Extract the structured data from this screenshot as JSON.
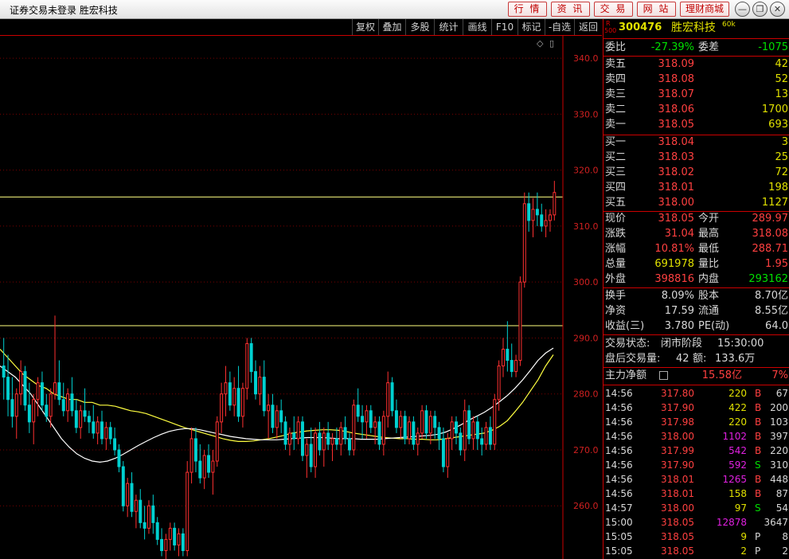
{
  "window": {
    "title": "证券交易未登录  胜宏科技",
    "nav": [
      "行 情",
      "资 讯",
      "交 易",
      "网 站",
      "理财商城"
    ],
    "controls": [
      "—",
      "❐",
      "✕"
    ]
  },
  "toolbar": [
    "复权",
    "叠加",
    "多股",
    "统计",
    "画线",
    "F10",
    "标记",
    "-自选",
    "返回"
  ],
  "chart": {
    "y_ticks": [
      "340.0",
      "330.0",
      "320.0",
      "310.0",
      "300.0",
      "290.0",
      "280.0",
      "270.0",
      "260.0"
    ],
    "top_icons": [
      "◇",
      "▯"
    ]
  },
  "chart_data": {
    "type": "candlestick",
    "title": "",
    "ylim": [
      250.5,
      344
    ],
    "y_ticks": [
      340,
      330,
      320,
      310,
      300,
      290,
      280,
      270,
      260
    ],
    "hlines": [
      315.2,
      292.2
    ],
    "grid": "horizontal dotted",
    "up_color": "#ff3030",
    "down_color": "#00d0d0",
    "ma_colors": [
      "#ffff40",
      "#ffffff"
    ],
    "candles": [
      [
        285,
        290,
        279,
        283
      ],
      [
        283,
        287,
        276,
        279
      ],
      [
        279,
        283,
        274,
        276
      ],
      [
        276,
        281,
        272,
        280
      ],
      [
        280,
        286,
        278,
        284
      ],
      [
        284,
        285,
        277,
        278
      ],
      [
        278,
        282,
        273,
        275
      ],
      [
        275,
        280,
        271,
        279
      ],
      [
        279,
        283,
        276,
        282
      ],
      [
        282,
        284,
        277,
        278
      ],
      [
        278,
        280,
        275,
        276
      ],
      [
        276,
        281,
        274,
        280
      ],
      [
        280,
        294,
        279,
        282
      ],
      [
        282,
        286,
        278,
        279
      ],
      [
        279,
        282,
        276,
        277
      ],
      [
        277,
        281,
        275,
        280
      ],
      [
        280,
        283,
        276,
        277
      ],
      [
        277,
        279,
        273,
        274
      ],
      [
        274,
        278,
        272,
        277
      ],
      [
        277,
        281,
        275,
        276
      ],
      [
        276,
        277,
        273,
        275
      ],
      [
        275,
        278,
        272,
        273
      ],
      [
        273,
        276,
        271,
        275
      ],
      [
        275,
        277,
        271,
        272
      ],
      [
        272,
        275,
        270,
        274
      ],
      [
        274,
        275,
        271,
        272
      ],
      [
        272,
        274,
        269,
        270
      ],
      [
        270,
        271,
        266,
        267
      ],
      [
        267,
        268,
        259,
        260
      ],
      [
        260,
        265,
        258,
        264
      ],
      [
        264,
        266,
        258,
        259
      ],
      [
        259,
        262,
        256,
        261
      ],
      [
        261,
        263,
        256,
        257
      ],
      [
        257,
        260,
        254,
        256
      ],
      [
        256,
        261,
        255,
        260
      ],
      [
        260,
        262,
        255,
        257
      ],
      [
        257,
        258,
        253,
        254
      ],
      [
        254,
        256,
        251,
        252
      ],
      [
        252,
        255,
        250.5,
        254
      ],
      [
        254,
        257,
        252,
        256
      ],
      [
        256,
        257,
        252,
        253
      ],
      [
        253,
        256,
        251,
        255
      ],
      [
        255,
        256,
        251,
        252
      ],
      [
        252,
        268,
        251,
        266
      ],
      [
        266,
        274,
        264,
        272
      ],
      [
        272,
        274,
        266,
        268
      ],
      [
        268,
        271,
        264,
        265
      ],
      [
        265,
        270,
        263,
        269
      ],
      [
        269,
        271,
        265,
        266
      ],
      [
        266,
        270,
        262,
        268
      ],
      [
        268,
        276,
        267,
        275
      ],
      [
        275,
        282,
        273,
        280
      ],
      [
        280,
        285,
        276,
        282
      ],
      [
        282,
        284,
        277,
        278
      ],
      [
        278,
        283,
        276,
        281
      ],
      [
        281,
        285,
        275,
        276
      ],
      [
        276,
        282,
        274,
        281
      ],
      [
        281,
        290,
        279,
        289
      ],
      [
        289,
        290,
        282,
        284
      ],
      [
        284,
        286,
        279,
        280
      ],
      [
        280,
        285,
        278,
        283
      ],
      [
        283,
        286,
        276,
        277
      ],
      [
        277,
        280,
        272,
        278
      ],
      [
        278,
        280,
        273,
        274
      ],
      [
        274,
        278,
        272,
        277
      ],
      [
        277,
        279,
        273,
        275
      ],
      [
        275,
        276,
        270,
        271
      ],
      [
        271,
        274,
        269,
        273
      ],
      [
        273,
        276,
        270,
        272
      ],
      [
        272,
        276,
        271,
        275
      ],
      [
        275,
        276,
        268,
        269
      ],
      [
        269,
        272,
        265,
        271
      ],
      [
        271,
        274,
        266,
        267
      ],
      [
        267,
        274,
        265,
        273
      ],
      [
        273,
        275,
        269,
        270
      ],
      [
        270,
        274,
        267,
        273
      ],
      [
        273,
        275,
        270,
        271
      ],
      [
        271,
        273,
        268,
        272
      ],
      [
        272,
        274,
        270,
        271
      ],
      [
        271,
        275,
        269,
        274
      ],
      [
        274,
        276,
        271,
        272
      ],
      [
        272,
        273,
        269,
        270
      ],
      [
        270,
        279,
        269,
        278
      ],
      [
        278,
        281,
        275,
        276
      ],
      [
        276,
        278,
        272,
        275
      ],
      [
        275,
        278,
        272,
        277
      ],
      [
        277,
        278,
        273,
        274
      ],
      [
        274,
        276,
        271,
        275
      ],
      [
        275,
        276,
        270,
        271
      ],
      [
        271,
        277,
        269,
        276
      ],
      [
        276,
        284,
        274,
        282
      ],
      [
        282,
        283,
        276,
        277
      ],
      [
        277,
        279,
        273,
        274
      ],
      [
        274,
        277,
        272,
        276
      ],
      [
        276,
        277,
        271,
        272
      ],
      [
        272,
        276,
        271,
        275
      ],
      [
        275,
        276,
        270,
        271
      ],
      [
        271,
        274,
        269,
        273
      ],
      [
        273,
        278,
        272,
        277
      ],
      [
        277,
        278,
        272,
        273
      ],
      [
        273,
        277,
        271,
        276
      ],
      [
        276,
        277,
        272,
        274
      ],
      [
        274,
        275,
        270,
        272
      ],
      [
        272,
        274,
        266,
        267
      ],
      [
        267,
        273,
        265,
        272
      ],
      [
        272,
        276,
        270,
        275
      ],
      [
        275,
        276,
        271,
        273
      ],
      [
        273,
        274,
        269,
        270
      ],
      [
        270,
        279,
        268,
        277
      ],
      [
        277,
        278,
        271,
        272
      ],
      [
        272,
        276,
        270,
        275
      ],
      [
        275,
        276,
        270,
        272
      ],
      [
        272,
        274,
        269,
        271
      ],
      [
        271,
        275,
        270,
        274
      ],
      [
        274,
        276,
        270,
        271
      ],
      [
        271,
        280,
        270,
        279
      ],
      [
        279,
        286,
        277,
        285
      ],
      [
        285,
        290,
        283,
        288
      ],
      [
        288,
        293,
        284,
        286
      ],
      [
        286,
        289,
        283,
        284
      ],
      [
        284,
        287,
        283,
        286
      ],
      [
        286,
        301,
        285,
        300
      ],
      [
        300,
        316,
        299,
        314
      ],
      [
        314,
        316,
        309,
        311
      ],
      [
        311,
        315,
        308,
        313
      ],
      [
        313,
        316,
        310,
        312
      ],
      [
        312,
        314,
        309,
        310
      ],
      [
        310,
        313,
        308,
        311
      ],
      [
        311,
        313,
        309,
        312
      ],
      [
        312,
        318.08,
        311,
        316
      ]
    ],
    "ma_short": [
      288,
      286.5,
      285,
      283.5,
      282.5,
      281.5,
      281,
      280,
      279.5,
      279,
      279,
      278.5,
      278.5,
      278,
      278,
      277.8,
      277.4,
      277,
      276.8,
      276.5,
      276,
      275.5,
      275,
      274.5,
      274,
      273.6,
      273.2,
      272.8,
      272.4,
      272,
      271.7,
      271.5,
      271.5,
      271.6,
      271.8,
      272,
      272.3,
      272.6,
      273,
      273.2,
      273.4,
      273.5,
      273.6,
      273.6,
      273.5,
      273.3,
      273,
      272.8,
      272.6,
      272.4,
      272.2,
      272.1,
      272,
      272,
      271.9,
      271.9,
      271.8,
      271.8,
      272,
      272.2,
      272.4,
      272.6,
      272.8,
      273,
      273.5,
      274.2,
      275.2,
      276.8,
      278.5,
      280.5,
      282.5,
      285,
      287
    ],
    "ma_long": [
      285,
      284,
      283,
      281.5,
      280,
      278,
      276,
      274,
      272,
      270.5,
      269.3,
      268.5,
      268,
      267.8,
      268,
      268.5,
      269.2,
      270,
      270.8,
      271.5,
      272.2,
      272.8,
      273.3,
      273.6,
      273.8,
      273.8,
      273.6,
      273.3,
      273,
      272.7,
      272.4,
      272.2,
      272,
      271.9,
      271.8,
      271.8,
      271.8,
      271.9,
      272,
      272.1,
      272.2,
      272.2,
      272.2,
      272.1,
      272,
      272,
      272,
      271.9,
      271.9,
      271.9,
      272,
      272.1,
      272.2,
      272.3,
      272.4,
      272.5,
      272.6,
      272.8,
      273.2,
      273.8,
      274.5,
      275.3,
      276,
      276.7,
      277.6,
      278.6,
      279.7,
      281,
      282.5,
      284.2,
      286,
      287.3,
      288.2
    ]
  },
  "quote": {
    "code": "300476",
    "name": "胜宏科技",
    "period": "60k",
    "badge": [
      "R",
      "500"
    ],
    "weibi": {
      "label": "委比",
      "value": "-27.39%",
      "label2": "委差",
      "value2": "-1075"
    },
    "asks": [
      {
        "label": "卖五",
        "price": "318.09",
        "vol": "42"
      },
      {
        "label": "卖四",
        "price": "318.08",
        "vol": "52"
      },
      {
        "label": "卖三",
        "price": "318.07",
        "vol": "13"
      },
      {
        "label": "卖二",
        "price": "318.06",
        "vol": "1700"
      },
      {
        "label": "卖一",
        "price": "318.05",
        "vol": "693"
      }
    ],
    "bids": [
      {
        "label": "买一",
        "price": "318.04",
        "vol": "3"
      },
      {
        "label": "买二",
        "price": "318.03",
        "vol": "25"
      },
      {
        "label": "买三",
        "price": "318.02",
        "vol": "72"
      },
      {
        "label": "买四",
        "price": "318.01",
        "vol": "198"
      },
      {
        "label": "买五",
        "price": "318.00",
        "vol": "1127"
      }
    ],
    "stats": [
      {
        "l1": "现价",
        "v1": "318.05",
        "l2": "今开",
        "v2": "289.97"
      },
      {
        "l1": "涨跌",
        "v1": "31.04",
        "l2": "最高",
        "v2": "318.08"
      },
      {
        "l1": "涨幅",
        "v1": "10.81%",
        "l2": "最低",
        "v2": "288.71"
      },
      {
        "l1": "总量",
        "v1": "691978",
        "l2": "量比",
        "v2": "1.95"
      },
      {
        "l1": "外盘",
        "v1": "398816",
        "l2": "内盘",
        "v2": "293162"
      }
    ],
    "fund": [
      {
        "l1": "换手",
        "v1": "8.09%",
        "l2": "股本",
        "v2": "8.70亿"
      },
      {
        "l1": "净资",
        "v1": "17.59",
        "l2": "流通",
        "v2": "8.55亿"
      },
      {
        "l1": "收益(三)",
        "v1": "3.780",
        "l2": "PE(动)",
        "v2": "64.0"
      }
    ],
    "status": {
      "label": "交易状态:",
      "value": "闭市阶段",
      "time": "15:30:00"
    },
    "after_hours": {
      "label": "盘后交易量:",
      "vol": "42",
      "amt_label": "额:",
      "amt": "133.6万"
    },
    "main_force": {
      "label": "主力净额",
      "value": "15.58亿",
      "pct": "7%"
    },
    "trades": [
      {
        "t": "14:56",
        "p": "317.80",
        "v": "220",
        "s": "B",
        "n": "67"
      },
      {
        "t": "14:56",
        "p": "317.90",
        "v": "422",
        "s": "B",
        "n": "200"
      },
      {
        "t": "14:56",
        "p": "317.98",
        "v": "220",
        "s": "B",
        "n": "103"
      },
      {
        "t": "14:56",
        "p": "318.00",
        "v": "1102",
        "s": "B",
        "n": "397"
      },
      {
        "t": "14:56",
        "p": "317.99",
        "v": "542",
        "s": "B",
        "n": "220"
      },
      {
        "t": "14:56",
        "p": "317.90",
        "v": "592",
        "s": "S",
        "n": "310"
      },
      {
        "t": "14:56",
        "p": "318.01",
        "v": "1265",
        "s": "B",
        "n": "448"
      },
      {
        "t": "14:56",
        "p": "318.01",
        "v": "158",
        "s": "B",
        "n": "87"
      },
      {
        "t": "14:57",
        "p": "318.00",
        "v": "97",
        "s": "S",
        "n": "54"
      },
      {
        "t": "15:00",
        "p": "318.05",
        "v": "12878",
        "s": "",
        "n": "3647"
      },
      {
        "t": "15:05",
        "p": "318.05",
        "v": "9",
        "s": "P",
        "n": "8"
      },
      {
        "t": "15:05",
        "p": "318.05",
        "v": "2",
        "s": "P",
        "n": "2"
      }
    ]
  }
}
